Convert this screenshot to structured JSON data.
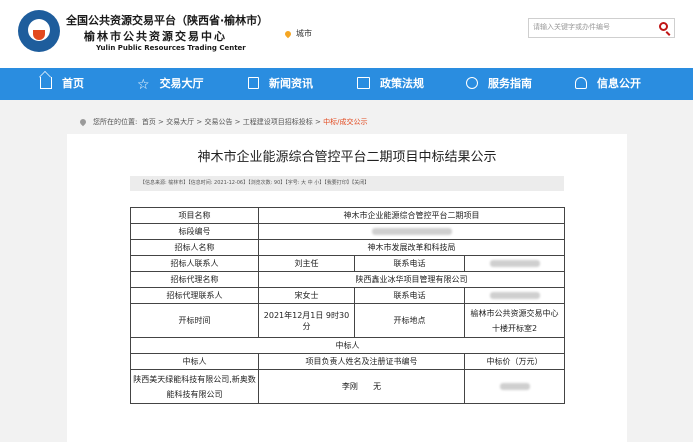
{
  "header": {
    "title_cn": "全国公共资源交易平台（陕西省·榆林市）",
    "subtitle_cn": "榆林市公共资源交易中心",
    "subtitle_en": "Yulin Public Resources Trading Center",
    "city": "城市",
    "search_placeholder": "请输入关键字或办件编号"
  },
  "nav": {
    "items": [
      {
        "label": "首页",
        "icon": "home-icon"
      },
      {
        "label": "交易大厅",
        "icon": "star-icon"
      },
      {
        "label": "新闻资讯",
        "icon": "document-icon"
      },
      {
        "label": "政策法规",
        "icon": "book-icon"
      },
      {
        "label": "服务指南",
        "icon": "compass-icon"
      },
      {
        "label": "信息公开",
        "icon": "hand-icon"
      }
    ]
  },
  "breadcrumb": {
    "prefix": "您所在的位置:",
    "path": "首页 > 交易大厅 > 交易公告 > 工程建设项目招标投标 >",
    "current": "中标/成交公示"
  },
  "article": {
    "title": "神木市企业能源综合管控平台二期项目中标结果公示",
    "meta": "【信息来源: 榆林市】【信息时间: 2021-12-06】【浏览次数: 90】【字号: 大 中 小】【我要打印】【关闭】"
  },
  "table": {
    "project_name_label": "项目名称",
    "project_name": "神木市企业能源综合管控平台二期项目",
    "section_no_label": "标段编号",
    "tenderer_label": "招标人名称",
    "tenderer": "神木市发展改革和科技局",
    "tenderer_contact_label": "招标人联系人",
    "tenderer_contact": "刘主任",
    "phone_label": "联系电话",
    "agent_label": "招标代理名称",
    "agent": "陕西鑫业冰华项目管理有限公司",
    "agent_contact_label": "招标代理联系人",
    "agent_contact": "宋女士",
    "phone_label_2": "联系电话",
    "open_time_label": "开标时间",
    "open_time": "2021年12月1日  9时30分",
    "open_place_label": "开标地点",
    "open_place": "榆林市公共资源交易中心十楼开标室2",
    "winner_section": "中标人",
    "winner_col": "中标人",
    "manager_col": "项目负责人姓名及注册证书编号",
    "price_col": "中标价（万元）",
    "winner": "陕西美天绿能科技有限公司,新奥数能科技有限公司",
    "manager": "李刚      无"
  }
}
